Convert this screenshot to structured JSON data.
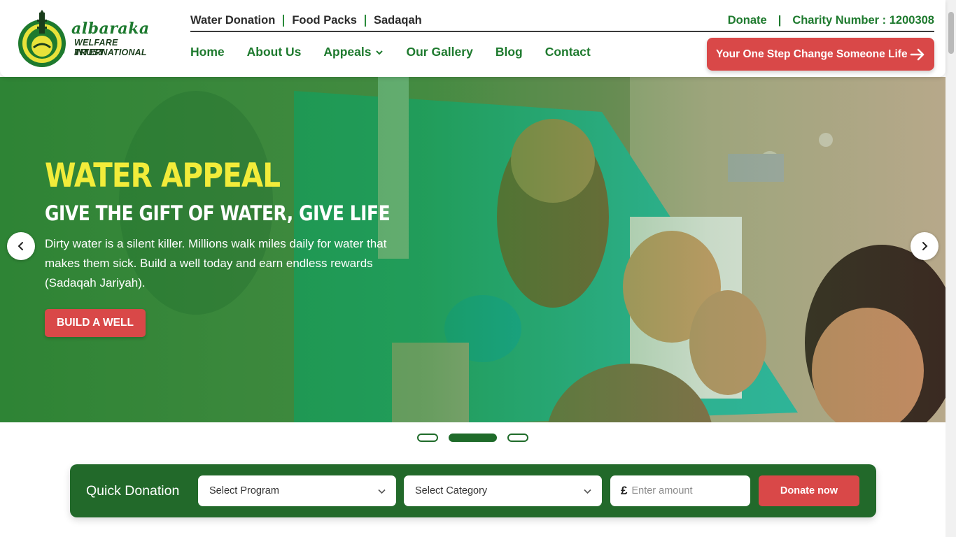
{
  "brand": {
    "script_name": "albaraka",
    "line1": "WELFARE TRUST",
    "line2": "INTERNATIONAL",
    "primary_color": "#1f6b2a",
    "accent_color": "#d94848",
    "highlight_color": "#f2ec3a"
  },
  "topbar": {
    "links": [
      {
        "label": "Water Donation"
      },
      {
        "label": "Food Packs"
      },
      {
        "label": "Sadaqah"
      }
    ],
    "donate_label": "Donate",
    "separator": "|",
    "charity_number": "Charity Number : 1200308"
  },
  "nav": {
    "items": [
      {
        "label": "Home"
      },
      {
        "label": "About Us"
      },
      {
        "label": "Appeals",
        "icon": "chevron-down-icon"
      },
      {
        "label": "Our Gallery"
      },
      {
        "label": "Blog"
      },
      {
        "label": "Contact"
      }
    ],
    "cta_label": "Your One Step Change Someone Life",
    "cta_icon": "arrow-right-icon"
  },
  "hero": {
    "title": "WATER APPEAL",
    "subtitle": "GIVE THE GIFT OF WATER, GIVE LIFE",
    "text": "Dirty water is a silent killer. Millions walk miles daily for water that makes them sick. Build a well today and earn endless rewards (Sadaqah Jariyah).",
    "button_label": "BUILD A WELL",
    "prev_icon": "chevron-left-icon",
    "next_icon": "chevron-right-icon",
    "slide_count": 3,
    "active_slide": 2
  },
  "quick_donation": {
    "label": "Quick Donation",
    "program_placeholder": "Select Program",
    "category_placeholder": "Select Category",
    "currency_symbol": "£",
    "amount_placeholder": "Enter amount",
    "button_label": "Donate now"
  }
}
